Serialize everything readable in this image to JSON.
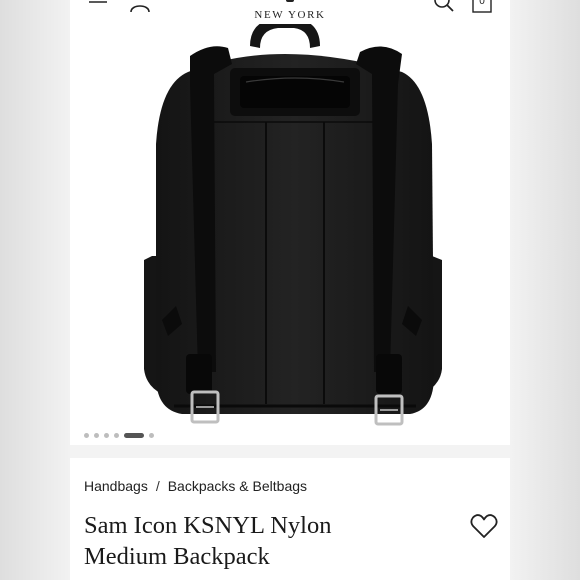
{
  "header": {
    "brand_location": "NEW YORK",
    "bag_count": "0",
    "icons": [
      "menu-icon",
      "account-icon",
      "search-icon",
      "shopping-bag-icon"
    ]
  },
  "gallery": {
    "image_alt": "black nylon backpack, back view",
    "slide_count": 6,
    "active_slide": 5
  },
  "breadcrumb": {
    "items": [
      "Handbags",
      "Backpacks & Beltbags"
    ],
    "separator": "/"
  },
  "product": {
    "title_line1": "Sam Icon KSNYL Nylon",
    "title_line2": "Medium Backpack",
    "wishlist_icon": "heart-icon"
  }
}
